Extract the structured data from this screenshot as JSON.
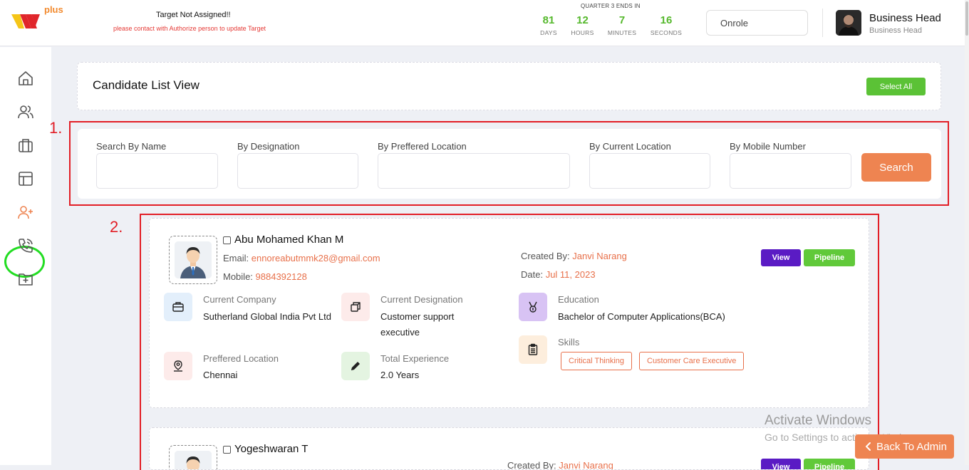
{
  "header": {
    "logo_text": "plus",
    "target_title": "Target Not Assigned!!",
    "target_sub": "please contact with Authorize person to update Target",
    "quarter_label": "QUARTER 3 ENDS IN",
    "countdown": [
      {
        "value": "81",
        "label": "DAYS"
      },
      {
        "value": "12",
        "label": "HOURS"
      },
      {
        "value": "7",
        "label": "MINUTES"
      },
      {
        "value": "16",
        "label": "SECONDS"
      }
    ],
    "role_select": "Onrole",
    "user_name": "Business Head",
    "user_role": "Business Head"
  },
  "sidebar": {
    "icons": [
      "home-icon",
      "users-icon",
      "briefcase-icon",
      "layout-icon",
      "user-plus-icon",
      "phone-call-icon",
      "folder-plus-icon"
    ],
    "active": "user-plus-icon"
  },
  "title_card": {
    "title": "Candidate List View",
    "select_all_label": "Select All"
  },
  "annotations": {
    "one": "1.",
    "two": "2."
  },
  "search": {
    "labels": [
      "Search By Name",
      "By Designation",
      "By Preffered Location",
      "By Current Location",
      "By Mobile Number"
    ],
    "button_label": "Search"
  },
  "candidates": [
    {
      "name": "Abu Mohamed Khan M",
      "email_label": "Email: ",
      "email": "ennoreabutmmk28@gmail.com",
      "mobile_label": "Mobile: ",
      "mobile": "9884392128",
      "created_by_label": "Created By: ",
      "created_by": "Janvi Narang",
      "date_label": "Date: ",
      "date": "Jul 11, 2023",
      "view_label": "View",
      "pipeline_label": "Pipeline",
      "current_company_label": "Current Company",
      "current_company": "Sutherland Global India Pvt Ltd",
      "current_designation_label": "Current Designation",
      "current_designation": "Customer support executive",
      "education_label": "Education",
      "education": "Bachelor of Computer Applications(BCA)",
      "preferred_location_label": "Preffered Location",
      "preferred_location": "Chennai",
      "total_experience_label": "Total Experience",
      "total_experience": "2.0 Years",
      "skills_label": "Skills",
      "skills": [
        "Critical Thinking",
        "Customer Care Executive"
      ]
    },
    {
      "name": "Yogeshwaran T",
      "created_by_label": "Created By: ",
      "created_by": "Janvi Narang",
      "view_label": "View",
      "pipeline_label": "Pipeline"
    }
  ],
  "overlay": {
    "activate_title": "Activate Windows",
    "activate_sub": "Go to Settings to activate Windows.",
    "back_label": "Back To Admin"
  },
  "colors": {
    "accent_orange": "#ee8451",
    "green": "#5bc236",
    "purple": "#5a1bc4",
    "annotation_red": "#e21e26",
    "active_ring": "#22dd22"
  }
}
